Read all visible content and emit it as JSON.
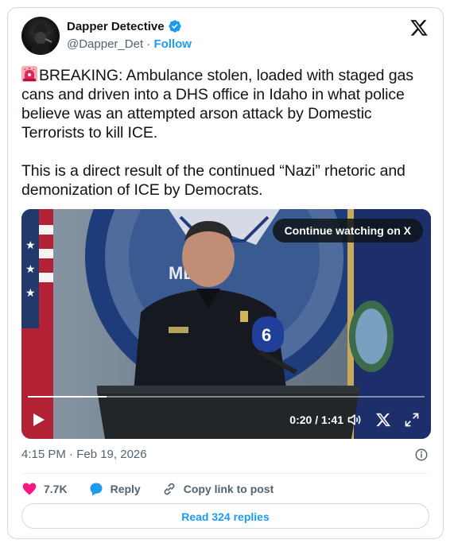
{
  "author": {
    "name": "Dapper Detective",
    "handle": "@Dapper_Det",
    "separator": "·",
    "follow_label": "Follow",
    "verified_icon": "verified-badge-icon",
    "brand_color": "#1d9bf0"
  },
  "tweet": {
    "paragraph1": "BREAKING: Ambulance stolen, loaded with staged gas cans and driven into a DHS office in Idaho in what police believe was an attempted arson attack by Domestic Terrorists to kill ICE.",
    "paragraph2": "This is a direct result of the continued “Nazi” rhetoric and demonization of ICE by Democrats.",
    "leading_emoji": "siren-icon"
  },
  "video": {
    "continue_label": "Continue watching on X",
    "time_display": "0:20 / 1:41",
    "progress": 0.198,
    "visible_partial_text": "ME   AN"
  },
  "meta": {
    "timestamp": "4:15 PM · Feb 19, 2026"
  },
  "actions": {
    "likes": "7.7K",
    "reply_label": "Reply",
    "copy_label": "Copy link to post",
    "like_color": "#f91880"
  },
  "read_replies_label": "Read 324 replies"
}
